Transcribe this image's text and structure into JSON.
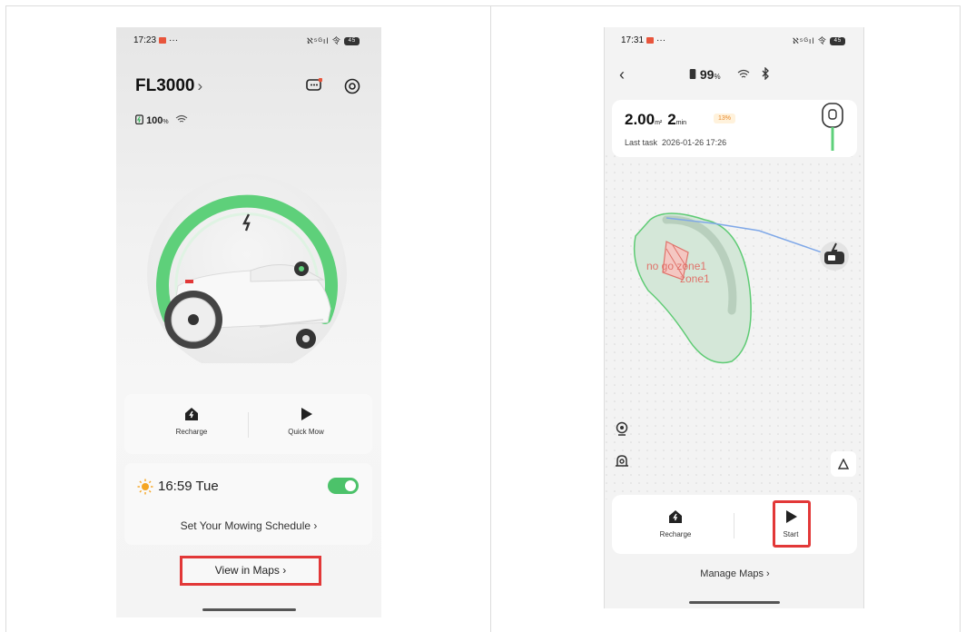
{
  "phone1": {
    "status_time": "17:23",
    "status_extra": "···",
    "status_icons": "ℵ⁵ᴳıl 令",
    "status_battery": "45",
    "device_name": "FL3000",
    "title_chevron": "›",
    "battery_value": "100",
    "battery_unit": "%",
    "recharge_label": "Recharge",
    "quick_mow_label": "Quick Mow",
    "schedule_time": "16:59",
    "schedule_day": "Tue",
    "schedule_enabled": true,
    "schedule_link": "Set Your Mowing Schedule ›",
    "view_maps_label": "View in Maps ›"
  },
  "phone2": {
    "status_time": "17:31",
    "status_extra": "···",
    "status_icons": "ℵ⁵ᴳıl 令",
    "status_battery": "45",
    "battery_value": "99",
    "battery_unit": "%",
    "back_label": "‹",
    "task_area": "2.00",
    "task_area_unit": "m²",
    "task_duration": "2",
    "task_duration_unit": "min",
    "task_progress": "13%",
    "task_meta_label": "Last task",
    "task_meta_date": "2026-01-26 17:26",
    "zone_label_1": "no go zone1",
    "zone_label_2": "zone1",
    "recharge_label": "Recharge",
    "start_label": "Start",
    "manage_maps_label": "Manage Maps ›"
  },
  "colors": {
    "accent_green": "#4cc26a",
    "highlight_red": "#e23838",
    "zone_red": "#e0726a",
    "path_blue": "#7fa8e8"
  }
}
